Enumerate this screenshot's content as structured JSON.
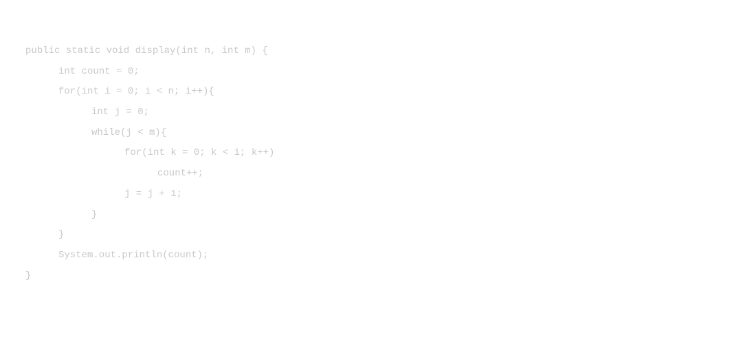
{
  "code": {
    "lines": [
      "public static void display(int n, int m) {",
      "int count = 0;",
      "for(int i = 0; i < n; i++){",
      "int j = 0;",
      "while(j < m){",
      "for(int k = 0; k < i; k++)",
      "count++;",
      "j = j + 1;",
      "}",
      "}",
      "System.out.println(count);",
      "}"
    ]
  }
}
